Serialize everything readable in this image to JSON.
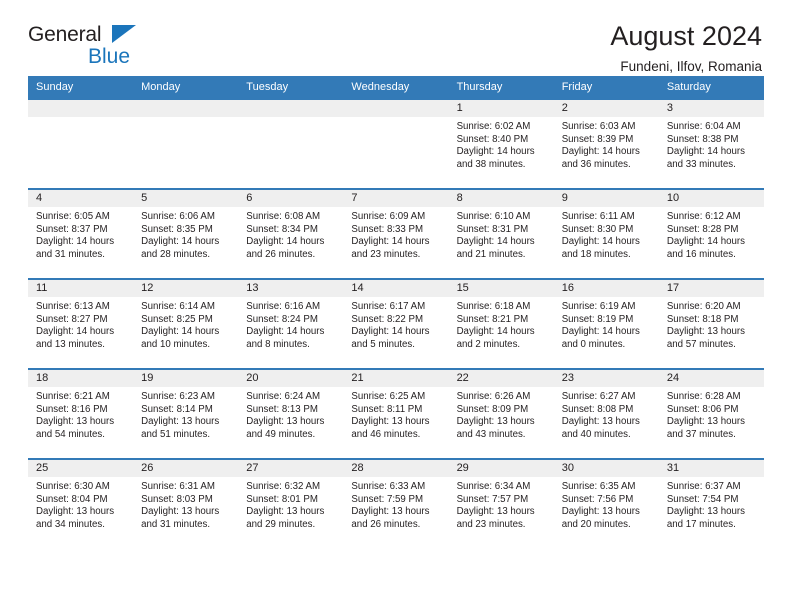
{
  "brand": {
    "name_top": "General",
    "name_bottom": "Blue",
    "accent_color": "#1b75bb"
  },
  "header": {
    "title": "August 2024",
    "subtitle": "Fundeni, Ilfov, Romania"
  },
  "calendar": {
    "header_color": "#337ab7",
    "daynum_band_color": "#efefef",
    "weekdays": [
      "Sunday",
      "Monday",
      "Tuesday",
      "Wednesday",
      "Thursday",
      "Friday",
      "Saturday"
    ],
    "weeks": [
      [
        {
          "day": "",
          "sunrise": "",
          "sunset": "",
          "daylight1": "",
          "daylight2": ""
        },
        {
          "day": "",
          "sunrise": "",
          "sunset": "",
          "daylight1": "",
          "daylight2": ""
        },
        {
          "day": "",
          "sunrise": "",
          "sunset": "",
          "daylight1": "",
          "daylight2": ""
        },
        {
          "day": "",
          "sunrise": "",
          "sunset": "",
          "daylight1": "",
          "daylight2": ""
        },
        {
          "day": "1",
          "sunrise": "Sunrise: 6:02 AM",
          "sunset": "Sunset: 8:40 PM",
          "daylight1": "Daylight: 14 hours",
          "daylight2": "and 38 minutes."
        },
        {
          "day": "2",
          "sunrise": "Sunrise: 6:03 AM",
          "sunset": "Sunset: 8:39 PM",
          "daylight1": "Daylight: 14 hours",
          "daylight2": "and 36 minutes."
        },
        {
          "day": "3",
          "sunrise": "Sunrise: 6:04 AM",
          "sunset": "Sunset: 8:38 PM",
          "daylight1": "Daylight: 14 hours",
          "daylight2": "and 33 minutes."
        }
      ],
      [
        {
          "day": "4",
          "sunrise": "Sunrise: 6:05 AM",
          "sunset": "Sunset: 8:37 PM",
          "daylight1": "Daylight: 14 hours",
          "daylight2": "and 31 minutes."
        },
        {
          "day": "5",
          "sunrise": "Sunrise: 6:06 AM",
          "sunset": "Sunset: 8:35 PM",
          "daylight1": "Daylight: 14 hours",
          "daylight2": "and 28 minutes."
        },
        {
          "day": "6",
          "sunrise": "Sunrise: 6:08 AM",
          "sunset": "Sunset: 8:34 PM",
          "daylight1": "Daylight: 14 hours",
          "daylight2": "and 26 minutes."
        },
        {
          "day": "7",
          "sunrise": "Sunrise: 6:09 AM",
          "sunset": "Sunset: 8:33 PM",
          "daylight1": "Daylight: 14 hours",
          "daylight2": "and 23 minutes."
        },
        {
          "day": "8",
          "sunrise": "Sunrise: 6:10 AM",
          "sunset": "Sunset: 8:31 PM",
          "daylight1": "Daylight: 14 hours",
          "daylight2": "and 21 minutes."
        },
        {
          "day": "9",
          "sunrise": "Sunrise: 6:11 AM",
          "sunset": "Sunset: 8:30 PM",
          "daylight1": "Daylight: 14 hours",
          "daylight2": "and 18 minutes."
        },
        {
          "day": "10",
          "sunrise": "Sunrise: 6:12 AM",
          "sunset": "Sunset: 8:28 PM",
          "daylight1": "Daylight: 14 hours",
          "daylight2": "and 16 minutes."
        }
      ],
      [
        {
          "day": "11",
          "sunrise": "Sunrise: 6:13 AM",
          "sunset": "Sunset: 8:27 PM",
          "daylight1": "Daylight: 14 hours",
          "daylight2": "and 13 minutes."
        },
        {
          "day": "12",
          "sunrise": "Sunrise: 6:14 AM",
          "sunset": "Sunset: 8:25 PM",
          "daylight1": "Daylight: 14 hours",
          "daylight2": "and 10 minutes."
        },
        {
          "day": "13",
          "sunrise": "Sunrise: 6:16 AM",
          "sunset": "Sunset: 8:24 PM",
          "daylight1": "Daylight: 14 hours",
          "daylight2": "and 8 minutes."
        },
        {
          "day": "14",
          "sunrise": "Sunrise: 6:17 AM",
          "sunset": "Sunset: 8:22 PM",
          "daylight1": "Daylight: 14 hours",
          "daylight2": "and 5 minutes."
        },
        {
          "day": "15",
          "sunrise": "Sunrise: 6:18 AM",
          "sunset": "Sunset: 8:21 PM",
          "daylight1": "Daylight: 14 hours",
          "daylight2": "and 2 minutes."
        },
        {
          "day": "16",
          "sunrise": "Sunrise: 6:19 AM",
          "sunset": "Sunset: 8:19 PM",
          "daylight1": "Daylight: 14 hours",
          "daylight2": "and 0 minutes."
        },
        {
          "day": "17",
          "sunrise": "Sunrise: 6:20 AM",
          "sunset": "Sunset: 8:18 PM",
          "daylight1": "Daylight: 13 hours",
          "daylight2": "and 57 minutes."
        }
      ],
      [
        {
          "day": "18",
          "sunrise": "Sunrise: 6:21 AM",
          "sunset": "Sunset: 8:16 PM",
          "daylight1": "Daylight: 13 hours",
          "daylight2": "and 54 minutes."
        },
        {
          "day": "19",
          "sunrise": "Sunrise: 6:23 AM",
          "sunset": "Sunset: 8:14 PM",
          "daylight1": "Daylight: 13 hours",
          "daylight2": "and 51 minutes."
        },
        {
          "day": "20",
          "sunrise": "Sunrise: 6:24 AM",
          "sunset": "Sunset: 8:13 PM",
          "daylight1": "Daylight: 13 hours",
          "daylight2": "and 49 minutes."
        },
        {
          "day": "21",
          "sunrise": "Sunrise: 6:25 AM",
          "sunset": "Sunset: 8:11 PM",
          "daylight1": "Daylight: 13 hours",
          "daylight2": "and 46 minutes."
        },
        {
          "day": "22",
          "sunrise": "Sunrise: 6:26 AM",
          "sunset": "Sunset: 8:09 PM",
          "daylight1": "Daylight: 13 hours",
          "daylight2": "and 43 minutes."
        },
        {
          "day": "23",
          "sunrise": "Sunrise: 6:27 AM",
          "sunset": "Sunset: 8:08 PM",
          "daylight1": "Daylight: 13 hours",
          "daylight2": "and 40 minutes."
        },
        {
          "day": "24",
          "sunrise": "Sunrise: 6:28 AM",
          "sunset": "Sunset: 8:06 PM",
          "daylight1": "Daylight: 13 hours",
          "daylight2": "and 37 minutes."
        }
      ],
      [
        {
          "day": "25",
          "sunrise": "Sunrise: 6:30 AM",
          "sunset": "Sunset: 8:04 PM",
          "daylight1": "Daylight: 13 hours",
          "daylight2": "and 34 minutes."
        },
        {
          "day": "26",
          "sunrise": "Sunrise: 6:31 AM",
          "sunset": "Sunset: 8:03 PM",
          "daylight1": "Daylight: 13 hours",
          "daylight2": "and 31 minutes."
        },
        {
          "day": "27",
          "sunrise": "Sunrise: 6:32 AM",
          "sunset": "Sunset: 8:01 PM",
          "daylight1": "Daylight: 13 hours",
          "daylight2": "and 29 minutes."
        },
        {
          "day": "28",
          "sunrise": "Sunrise: 6:33 AM",
          "sunset": "Sunset: 7:59 PM",
          "daylight1": "Daylight: 13 hours",
          "daylight2": "and 26 minutes."
        },
        {
          "day": "29",
          "sunrise": "Sunrise: 6:34 AM",
          "sunset": "Sunset: 7:57 PM",
          "daylight1": "Daylight: 13 hours",
          "daylight2": "and 23 minutes."
        },
        {
          "day": "30",
          "sunrise": "Sunrise: 6:35 AM",
          "sunset": "Sunset: 7:56 PM",
          "daylight1": "Daylight: 13 hours",
          "daylight2": "and 20 minutes."
        },
        {
          "day": "31",
          "sunrise": "Sunrise: 6:37 AM",
          "sunset": "Sunset: 7:54 PM",
          "daylight1": "Daylight: 13 hours",
          "daylight2": "and 17 minutes."
        }
      ]
    ]
  }
}
